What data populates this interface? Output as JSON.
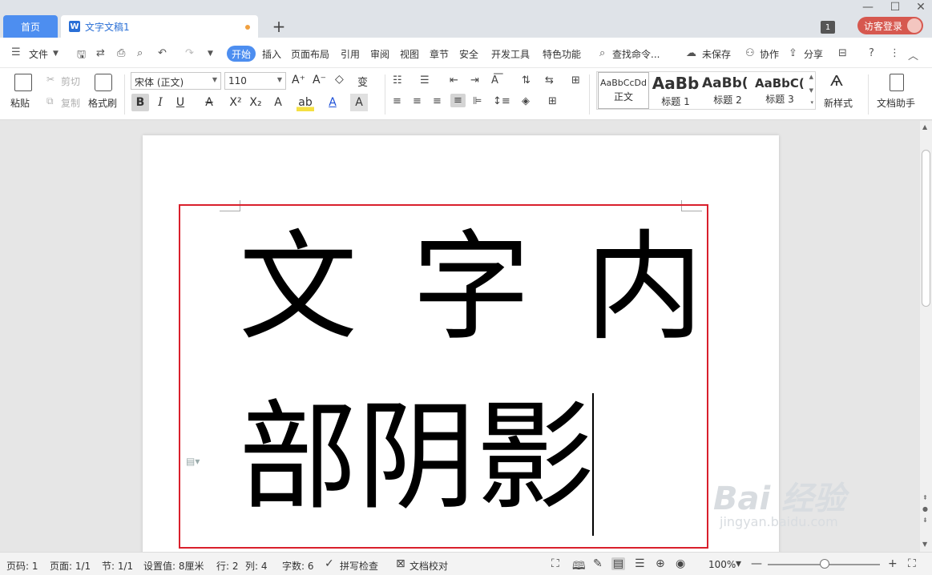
{
  "tabs": {
    "home": "首页",
    "doc": "文字文稿1",
    "add": "+"
  },
  "window": {
    "badge": "1",
    "login": "访客登录"
  },
  "menu": {
    "file": "文件",
    "items": [
      "开始",
      "插入",
      "页面布局",
      "引用",
      "审阅",
      "视图",
      "章节",
      "安全",
      "开发工具",
      "特色功能"
    ],
    "search": "查找命令...",
    "unsaved": "未保存",
    "collab": "协作",
    "share": "分享"
  },
  "ribbon": {
    "paste": "粘贴",
    "cut": "剪切",
    "copy": "复制",
    "format_painter": "格式刷",
    "font_name": "宋体 (正文)",
    "font_size": "110",
    "styles": [
      {
        "sample": "AaBbCcDd",
        "name": "正文"
      },
      {
        "sample": "AaBb",
        "name": "标题 1"
      },
      {
        "sample": "AaBb(",
        "name": "标题 2"
      },
      {
        "sample": "AaBbC(",
        "name": "标题 3"
      }
    ],
    "new_style": "新样式",
    "doc_assistant": "文档助手"
  },
  "document": {
    "line1": "文字内",
    "line2": "部阴影"
  },
  "watermark": {
    "main": "Bai 经验",
    "sub": "jingyan.baidu.com"
  },
  "status": {
    "page_num": "页码: 1",
    "page": "页面: 1/1",
    "section": "节: 1/1",
    "setting": "设置值: 8厘米",
    "row": "行: 2",
    "col": "列: 4",
    "chars": "字数: 6",
    "spell": "拼写检查",
    "proof": "文档校对",
    "zoom": "100%"
  },
  "colors": {
    "accent": "#4d8ef0",
    "login": "#d6584f",
    "selection_border": "#d9202c"
  }
}
